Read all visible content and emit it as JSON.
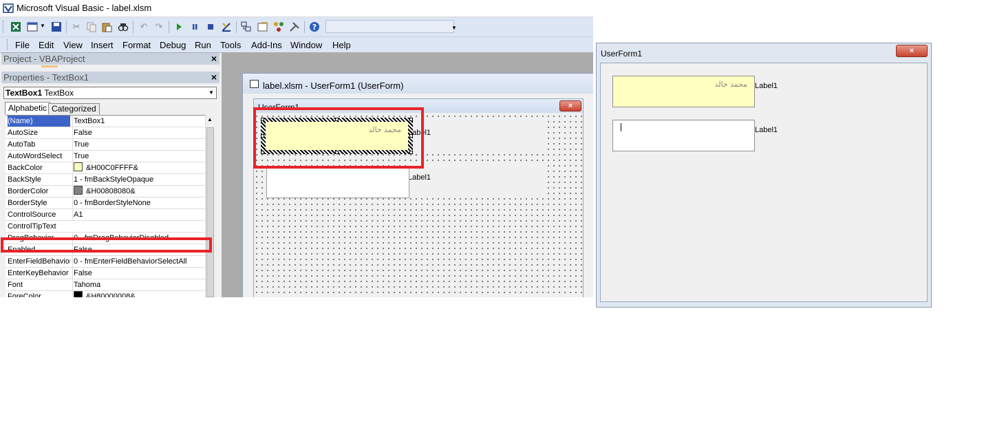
{
  "vbe": {
    "title": "Microsoft Visual Basic - label.xlsm",
    "menu": [
      "File",
      "Edit",
      "View",
      "Insert",
      "Format",
      "Debug",
      "Run",
      "Tools",
      "Add-Ins",
      "Window",
      "Help"
    ],
    "toolbar_icons": [
      "excel-icon",
      "insert-userform-icon",
      "save-icon",
      "cut-icon",
      "copy-icon",
      "paste-icon",
      "find-icon",
      "undo-icon",
      "redo-icon",
      "run-icon",
      "break-icon",
      "reset-icon",
      "design-mode-icon",
      "project-explorer-icon",
      "properties-window-icon",
      "object-browser-icon",
      "toolbox-icon",
      "help-icon"
    ]
  },
  "project_panel": {
    "title": "Project - VBAProject",
    "close": "×"
  },
  "properties_panel": {
    "title": "Properties - TextBox1",
    "close": "×",
    "object_name": "TextBox1",
    "object_type": "TextBox",
    "tabs": [
      "Alphabetic",
      "Categorized"
    ],
    "rows": [
      {
        "name": "(Name)",
        "value": "TextBox1"
      },
      {
        "name": "AutoSize",
        "value": "False"
      },
      {
        "name": "AutoTab",
        "value": "True"
      },
      {
        "name": "AutoWordSelect",
        "value": "True"
      },
      {
        "name": "BackColor",
        "value": "&H00C0FFFF&",
        "swatch": "#ffffc0"
      },
      {
        "name": "BackStyle",
        "value": "1 - fmBackStyleOpaque"
      },
      {
        "name": "BorderColor",
        "value": "&H00808080&",
        "swatch": "#808080"
      },
      {
        "name": "BorderStyle",
        "value": "0 - fmBorderStyleNone"
      },
      {
        "name": "ControlSource",
        "value": "A1"
      },
      {
        "name": "ControlTipText",
        "value": ""
      },
      {
        "name": "DragBehavior",
        "value": "0 - fmDragBehaviorDisabled"
      },
      {
        "name": "Enabled",
        "value": "False"
      },
      {
        "name": "EnterFieldBehavior",
        "value": "0 - fmEnterFieldBehaviorSelectAll"
      },
      {
        "name": "EnterKeyBehavior",
        "value": "False"
      },
      {
        "name": "Font",
        "value": "Tahoma"
      },
      {
        "name": "ForeColor",
        "value": "&H80000008&",
        "swatch": "#000000"
      }
    ]
  },
  "designer": {
    "window_title": "label.xlsm - UserForm1 (UserForm)",
    "form_title": "UserForm1",
    "close": "×",
    "textbox1_text": "محمد خالد",
    "label_top": "Label1",
    "label_bottom": "Label1"
  },
  "runtime_form": {
    "title": "UserForm1",
    "close": "×",
    "textbox1_text": "محمد خالد",
    "label_top": "Label1",
    "label_bottom": "Label1"
  },
  "colors": {
    "highlight": "#e8232a",
    "selection": "#3c64c8",
    "textbox_back": "#ffffc0"
  }
}
